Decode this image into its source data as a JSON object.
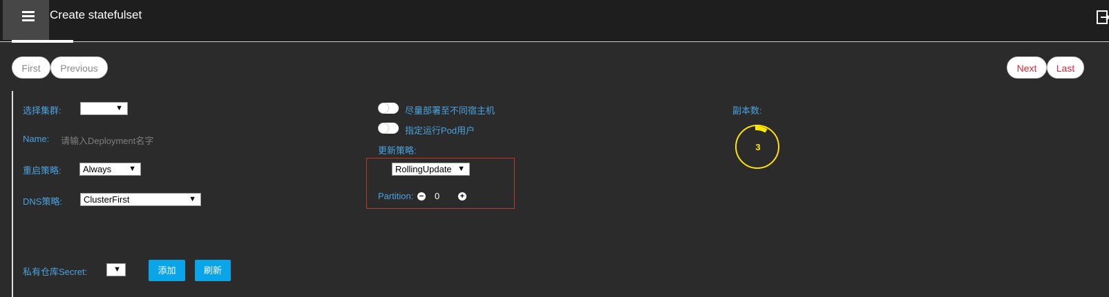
{
  "header": {
    "title": "Create statefulset"
  },
  "pager": {
    "first": "First",
    "previous": "Previous",
    "next": "Next",
    "last": "Last"
  },
  "form": {
    "cluster_label": "选择集群:",
    "cluster_value": "",
    "name_label": "Name:",
    "name_placeholder": "请输入Deployment名字",
    "restart_label": "重启策略:",
    "restart_value": "Always",
    "dns_label": "DNS策略:",
    "dns_value": "ClusterFirst",
    "secret_label": "私有仓库Secret:",
    "secret_value": "",
    "add_button": "添加",
    "refresh_button": "刷新",
    "spread_hosts_label": "尽量部署至不同宿主机",
    "pod_user_label": "指定运行Pod用户",
    "update_strategy_label": "更新策略:",
    "update_strategy_value": "RollingUpdate",
    "partition_label": "Partition:",
    "partition_value": "0",
    "replicas_label": "副本数:",
    "replicas_value": "3"
  },
  "colors": {
    "accent_blue": "#0aa5e8",
    "label_blue": "#4aa3df",
    "pager_red": "#d9263a",
    "replica_yellow": "#ffe600",
    "highlight_box": "#c0392b"
  }
}
